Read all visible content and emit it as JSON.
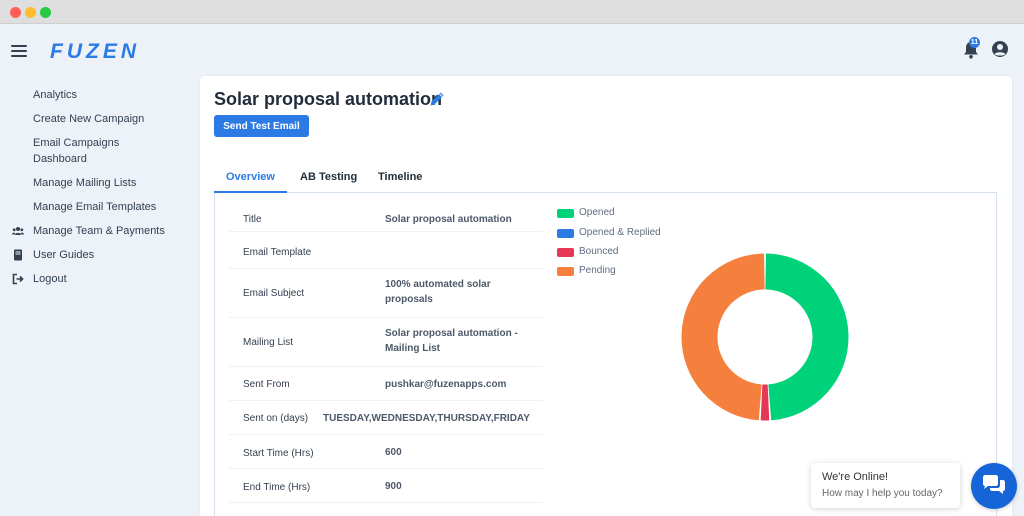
{
  "app": {
    "logo": "FUZEN",
    "notification_count": "11"
  },
  "sidebar": {
    "items": [
      {
        "label": "Analytics",
        "icon": ""
      },
      {
        "label": "Create New Campaign",
        "icon": ""
      },
      {
        "label": "Email Campaigns Dashboard",
        "icon": ""
      },
      {
        "label": "Manage Mailing Lists",
        "icon": ""
      },
      {
        "label": "Manage Email Templates",
        "icon": ""
      },
      {
        "label": "Manage Team & Payments",
        "icon": "users-icon"
      },
      {
        "label": "User Guides",
        "icon": "book-icon"
      },
      {
        "label": "Logout",
        "icon": "logout-icon"
      }
    ]
  },
  "campaign": {
    "title": "Solar proposal automation",
    "send_test_label": "Send Test Email"
  },
  "tabs": [
    {
      "label": "Overview",
      "active": true
    },
    {
      "label": "AB Testing",
      "active": false
    },
    {
      "label": "Timeline",
      "active": false
    }
  ],
  "details": [
    {
      "label": "Title",
      "value": "Solar proposal automation"
    },
    {
      "label": "Email Template",
      "value": ""
    },
    {
      "label": "Email Subject",
      "value": "100% automated solar proposals"
    },
    {
      "label": "Mailing List",
      "value": "Solar proposal automation - Mailing List"
    },
    {
      "label": "Sent From",
      "value": "pushkar@fuzenapps.com"
    },
    {
      "label": "Sent on (days)",
      "value": "TUESDAY,WEDNESDAY,THURSDAY,FRIDAY"
    },
    {
      "label": "Start Time (Hrs)",
      "value": "600"
    },
    {
      "label": "End Time (Hrs)",
      "value": "900"
    }
  ],
  "chart_data": {
    "type": "pie",
    "subtype": "donut",
    "labels": [
      "Opened",
      "Opened & Replied",
      "Bounced",
      "Pending"
    ],
    "values": [
      49,
      0,
      2,
      49
    ],
    "colors": [
      "#00d27a",
      "#2c7be5",
      "#e63757",
      "#f5803e"
    ],
    "legend_position": "top-left"
  },
  "chat": {
    "title": "We're Online!",
    "subtitle": "How may I help you today?"
  },
  "colors": {
    "primary": "#2c7be5",
    "background": "#edf2f9"
  }
}
